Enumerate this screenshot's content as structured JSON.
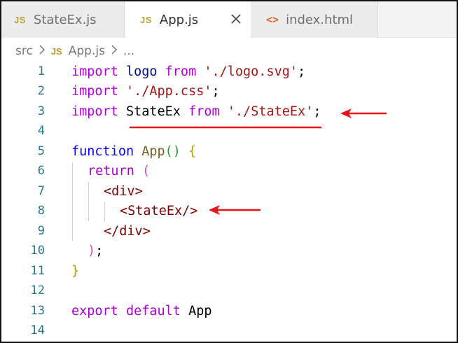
{
  "tabs": [
    {
      "badge": "JS",
      "label": "StateEx.js",
      "active": false
    },
    {
      "badge": "JS",
      "label": "App.js",
      "active": true
    },
    {
      "badge": "<>",
      "label": "index.html",
      "active": false
    }
  ],
  "breadcrumb": {
    "folder": "src",
    "file_badge": "JS",
    "file": "App.js",
    "more": "..."
  },
  "code": {
    "line1": {
      "n": "1",
      "t1": "import",
      "t2": " logo ",
      "t3": "from",
      "t4": " ",
      "t5": "'./logo.svg'",
      "t6": ";"
    },
    "line2": {
      "n": "2",
      "t1": "import",
      "t2": " ",
      "t3": "'./App.css'",
      "t4": ";"
    },
    "line3": {
      "n": "3",
      "t1": "import",
      "t2": " StateEx ",
      "t3": "from",
      "t4": " ",
      "t5": "'./StateEx'",
      "t6": ";"
    },
    "line4": {
      "n": "4"
    },
    "line5": {
      "n": "5",
      "t1": "function",
      "t2": " ",
      "t3": "App",
      "t4": "()",
      "t5": " ",
      "t6": "{"
    },
    "line6": {
      "n": "6",
      "t1": "return",
      "t2": " ",
      "t3": "("
    },
    "line7": {
      "n": "7",
      "t1": "<",
      "t2": "div",
      "t3": ">"
    },
    "line8": {
      "n": "8",
      "t1": "<",
      "t2": "StateEx",
      "t3": "/>"
    },
    "line9": {
      "n": "9",
      "t1": "</",
      "t2": "div",
      "t3": ">"
    },
    "line10": {
      "n": "10",
      "t1": ")",
      "t2": ";"
    },
    "line11": {
      "n": "11",
      "t1": "}"
    },
    "line12": {
      "n": "12"
    },
    "line13": {
      "n": "13",
      "t1": "export",
      "t2": " ",
      "t3": "default",
      "t4": " App"
    },
    "line14": {
      "n": "14"
    }
  },
  "annotation_color": "#e8141b",
  "icons": {
    "close": "close-icon",
    "chevron": "chevron-right-icon"
  }
}
